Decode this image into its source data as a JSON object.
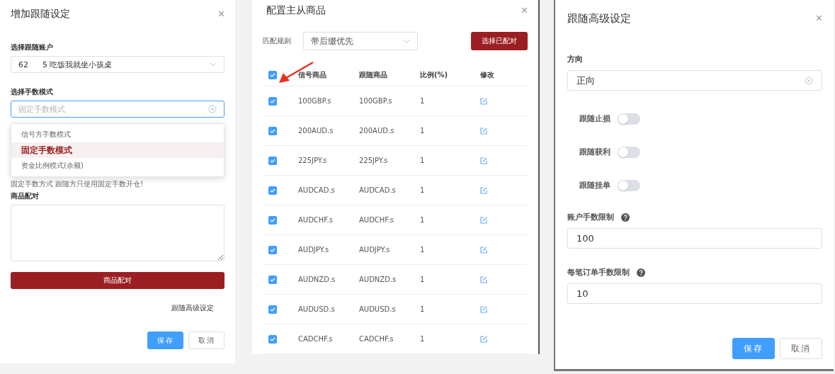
{
  "follow_dialog": {
    "title": "增加跟随设定",
    "close": "×",
    "account": {
      "label": "选择跟随账户",
      "value_start": "62",
      "value_end": "5 吃饭我就坐小孩桌"
    },
    "lot_mode": {
      "label": "选择手数模式",
      "placeholder": "固定手数模式",
      "expanded": true,
      "options": [
        {
          "label": "信号方手数模式",
          "selected": false
        },
        {
          "label": "固定手数模式",
          "selected": true
        },
        {
          "label": "资金比例模式(余额)",
          "selected": false
        }
      ]
    },
    "hint": "固定手数方式 跟随方只使用固定手数开仓!",
    "pairing": {
      "label": "商品配对",
      "button": "商品配对"
    },
    "advanced_link": "跟随高级设定",
    "buttons": [
      "保存",
      "取消"
    ]
  },
  "symbol_dialog": {
    "title": "配置主从商品",
    "close": "×",
    "rule": {
      "label": "匹配规则",
      "value": "带后缀优先"
    },
    "select_button": "选择已配对",
    "table": {
      "all_checked": true,
      "columns": [
        "信号商品",
        "跟随商品",
        "比例(%)",
        "修改"
      ],
      "rows": [
        {
          "checked": true,
          "signal": "100GBP.s",
          "follow": "100GBP.s",
          "ratio": "1"
        },
        {
          "checked": true,
          "signal": "200AUD.s",
          "follow": "200AUD.s",
          "ratio": "1"
        },
        {
          "checked": true,
          "signal": "225JPY.s",
          "follow": "225JPY.s",
          "ratio": "1"
        },
        {
          "checked": true,
          "signal": "AUDCAD.s",
          "follow": "AUDCAD.s",
          "ratio": "1"
        },
        {
          "checked": true,
          "signal": "AUDCHF.s",
          "follow": "AUDCHF.s",
          "ratio": "1"
        },
        {
          "checked": true,
          "signal": "AUDJPY.s",
          "follow": "AUDJPY.s",
          "ratio": "1"
        },
        {
          "checked": true,
          "signal": "AUDNZD.s",
          "follow": "AUDNZD.s",
          "ratio": "1"
        },
        {
          "checked": true,
          "signal": "AUDUSD.s",
          "follow": "AUDUSD.s",
          "ratio": "1"
        },
        {
          "checked": true,
          "signal": "CADCHF.s",
          "follow": "CADCHF.s",
          "ratio": "1"
        }
      ]
    }
  },
  "advanced_dialog": {
    "title": "跟随高级设定",
    "close": "×",
    "direction": {
      "label": "方向",
      "value": "正向"
    },
    "switches": [
      {
        "label": "跟随止损",
        "on": false
      },
      {
        "label": "跟随获利",
        "on": false
      },
      {
        "label": "跟随挂单",
        "on": false
      }
    ],
    "account_limit": {
      "label": "账户手数限制",
      "value": "100"
    },
    "order_limit": {
      "label": "每笔订单手数限制",
      "value": "10"
    },
    "buttons": [
      "保存",
      "取消"
    ]
  }
}
